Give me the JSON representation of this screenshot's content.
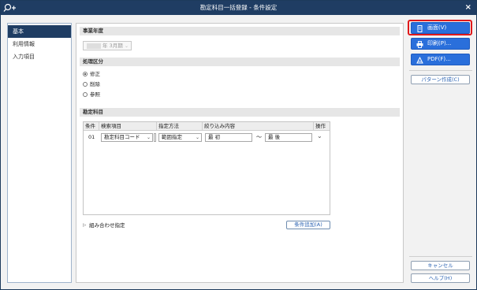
{
  "window": {
    "title": "勘定科目一括登録 - 条件設定"
  },
  "sidebar": {
    "items": [
      {
        "label": "基本"
      },
      {
        "label": "利用情報"
      },
      {
        "label": "入力項目"
      }
    ]
  },
  "sections": {
    "fiscal_year": {
      "title": "事業年度",
      "year_suffix": "年",
      "period": "3月期"
    },
    "processing": {
      "title": "処理区分",
      "options": [
        "修正",
        "削除",
        "参照"
      ],
      "selected": "修正"
    },
    "accounts": {
      "title": "勘定科目",
      "columns": [
        "条件",
        "検索項目",
        "指定方法",
        "絞り込み内容",
        "操作"
      ],
      "rows": [
        {
          "condition": "01",
          "search_item": "勘定科目コード",
          "method": "範囲指定",
          "from": "最 初",
          "separator": "〜",
          "to": "最 後"
        }
      ],
      "combo_label": "組み合わせ指定",
      "add_condition_button": "条件追加(A)"
    }
  },
  "actions": {
    "screen_button": "画面(V)",
    "print_button": "印刷(P)...",
    "pdf_button": "PDF(F)...",
    "pattern_button": "パターン作成(C)",
    "cancel_button": "キャンセル",
    "help_button": "ヘルプ(H)"
  },
  "colors": {
    "titlebar": "#1f3d63",
    "primary_button": "#2a6fdb",
    "focus_ring": "#e0191b",
    "link_text": "#2d64b3"
  }
}
